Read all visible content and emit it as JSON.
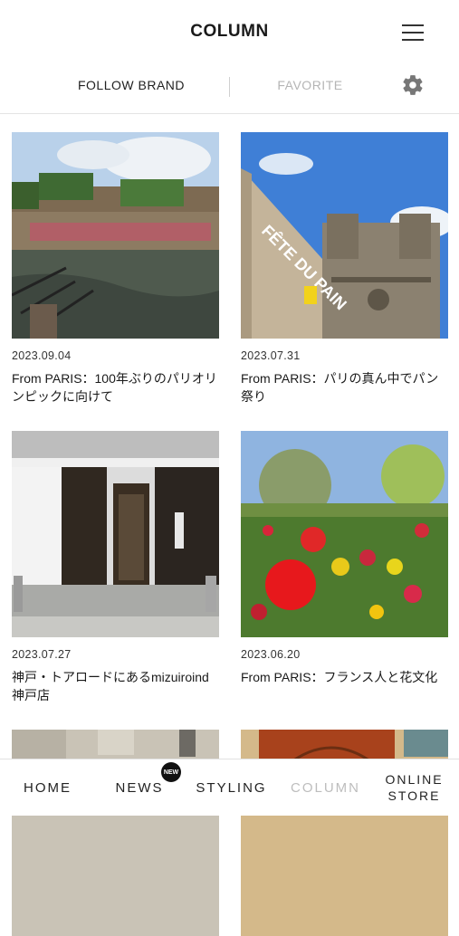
{
  "header": {
    "title": "COLUMN"
  },
  "subtabs": {
    "follow_label": "FOLLOW BRAND",
    "favorite_label": "FAVORITE"
  },
  "articles": [
    {
      "date": "2023.09.04",
      "title": "From PARIS：100年ぶりのパリオリンピックに向けて"
    },
    {
      "date": "2023.07.31",
      "title": "From PARIS：パリの真ん中でパン祭り",
      "sign_text": "FÊTE DU PAIN"
    },
    {
      "date": "2023.07.27",
      "title": "神戸・トアロードにあるmizuiroind 神戸店"
    },
    {
      "date": "2023.06.20",
      "title": "From PARIS：フランス人と花文化"
    },
    {
      "date": "",
      "title": ""
    },
    {
      "date": "",
      "title": ""
    }
  ],
  "tabbar": {
    "home": "HOME",
    "news": "NEWS",
    "news_badge": "NEW",
    "styling": "STYLING",
    "column": "COLUMN",
    "online_line1": "ONLINE",
    "online_line2": "STORE"
  },
  "colors": {
    "active_tab": "#bdbdbd",
    "inactive_subtab": "#b5b5b5",
    "badge": "#111111"
  },
  "icons": [
    "hamburger-menu-icon",
    "gear-icon"
  ]
}
